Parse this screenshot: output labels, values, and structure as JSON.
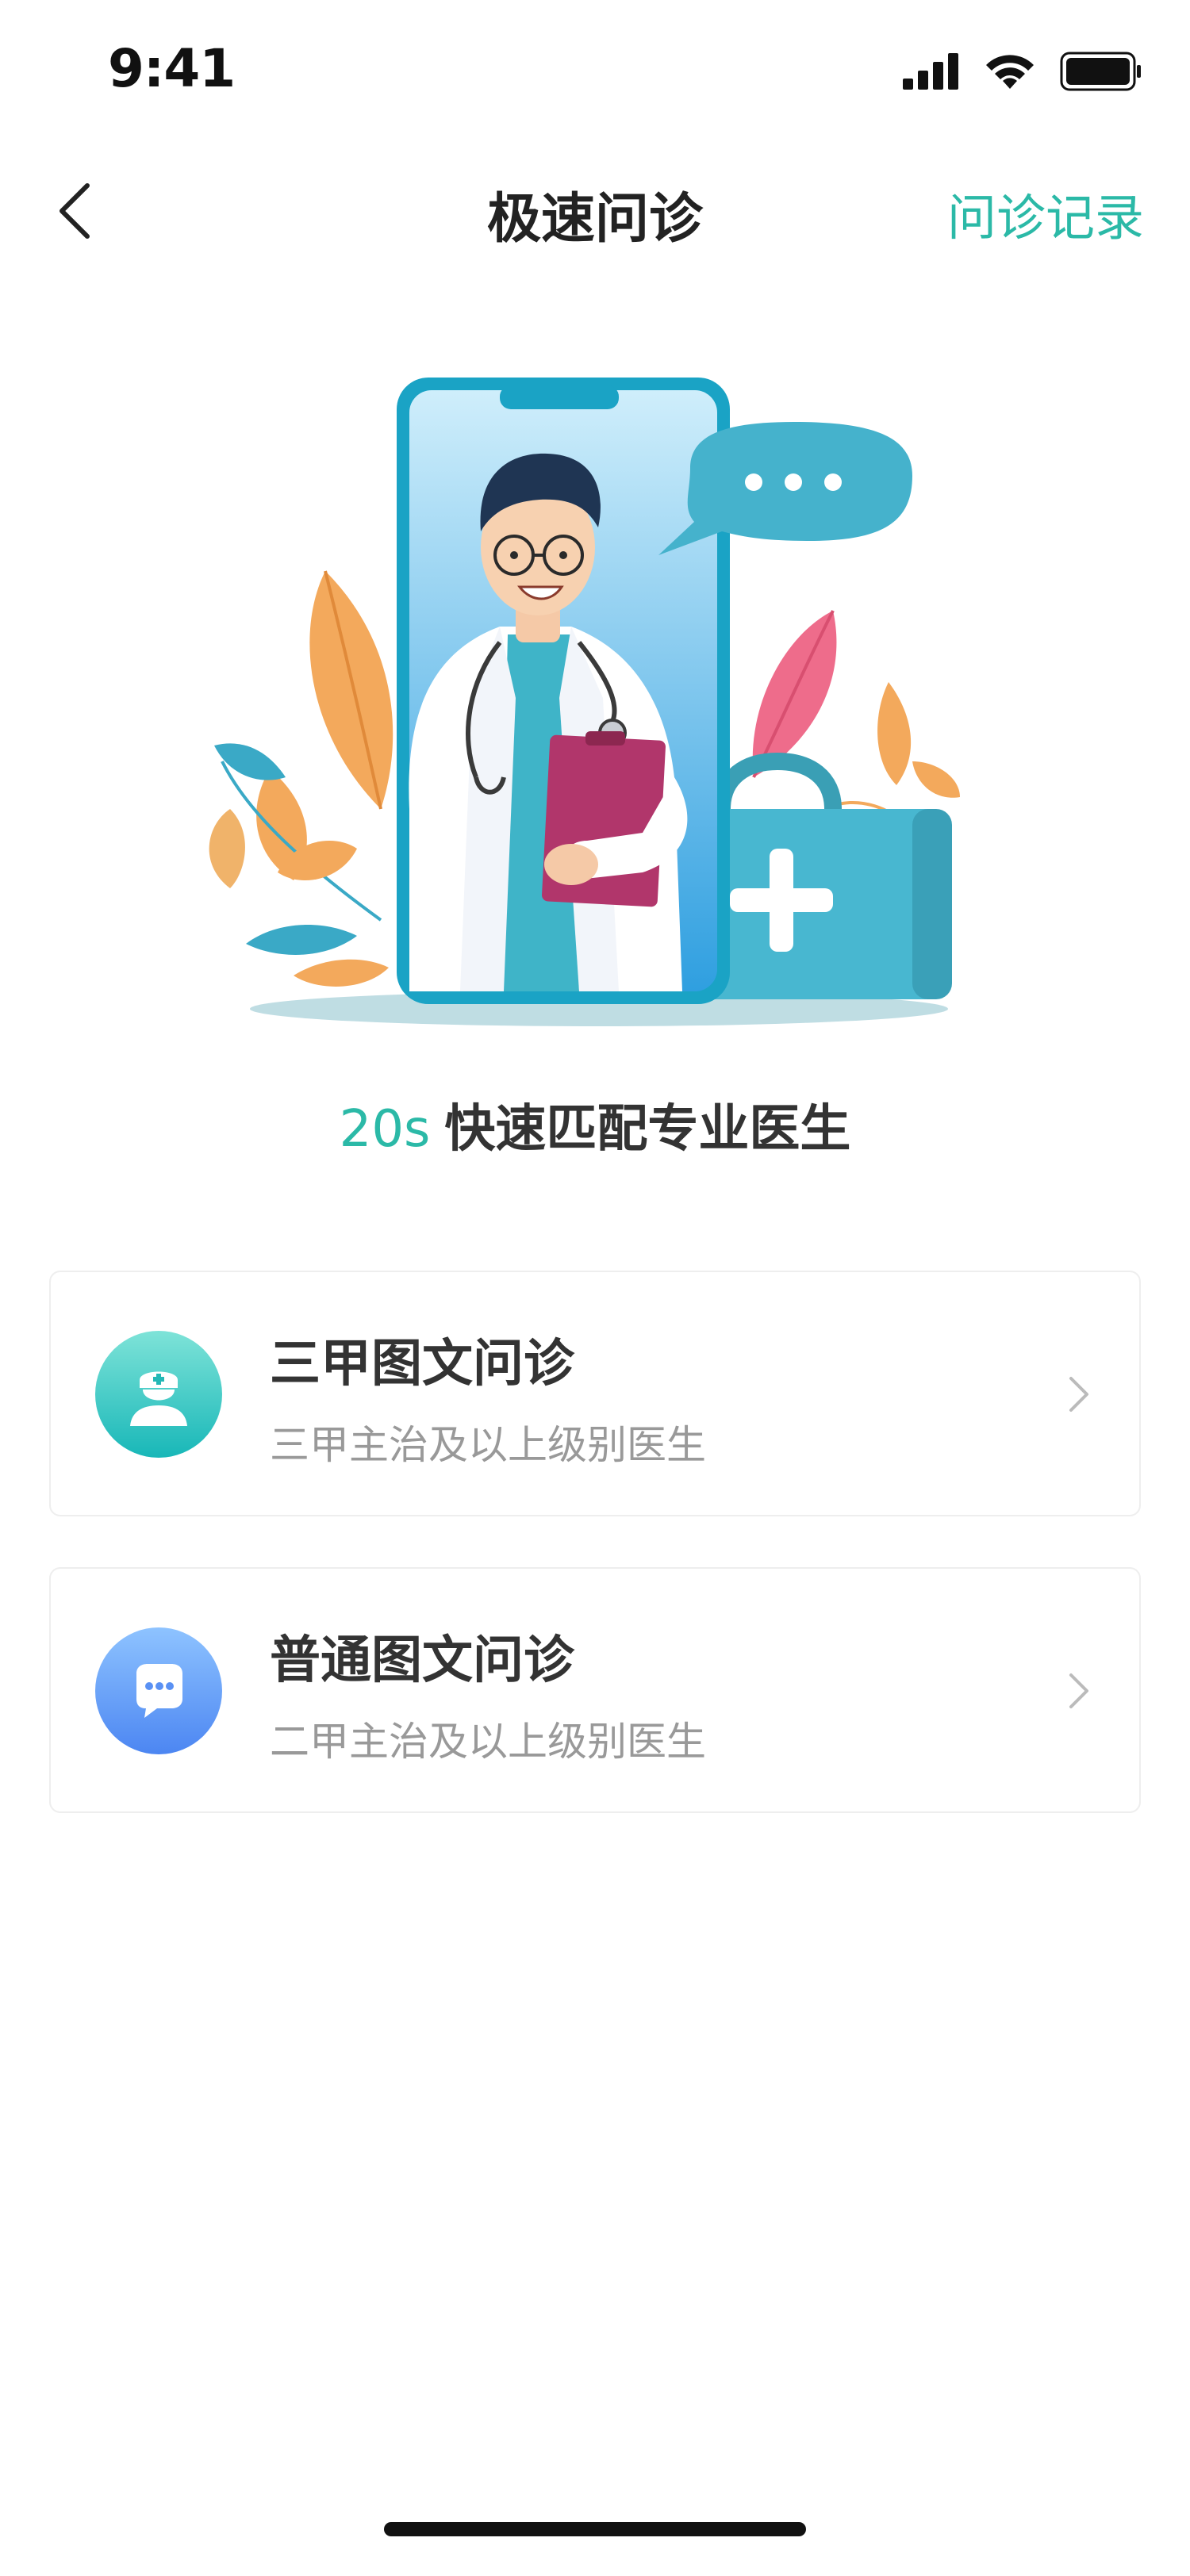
{
  "status_bar": {
    "time": "9:41"
  },
  "nav": {
    "title": "极速问诊",
    "records_link": "问诊记录"
  },
  "hero": {
    "tagline_accent": "20s",
    "tagline_text": "快速匹配专业医生"
  },
  "options": [
    {
      "title": "三甲图文问诊",
      "subtitle": "三甲主治及以上级别医生",
      "icon": "nurse-icon"
    },
    {
      "title": "普通图文问诊",
      "subtitle": "二甲主治及以上级别医生",
      "icon": "chat-bubble-icon"
    }
  ],
  "colors": {
    "accent": "#2bb9a7",
    "card_border": "#eeeeee",
    "subtitle": "#999999",
    "option1_icon_gradient": [
      "#7ee3d8",
      "#18b7b8"
    ],
    "option2_icon_gradient": [
      "#8ec3ff",
      "#4c86f2"
    ]
  }
}
